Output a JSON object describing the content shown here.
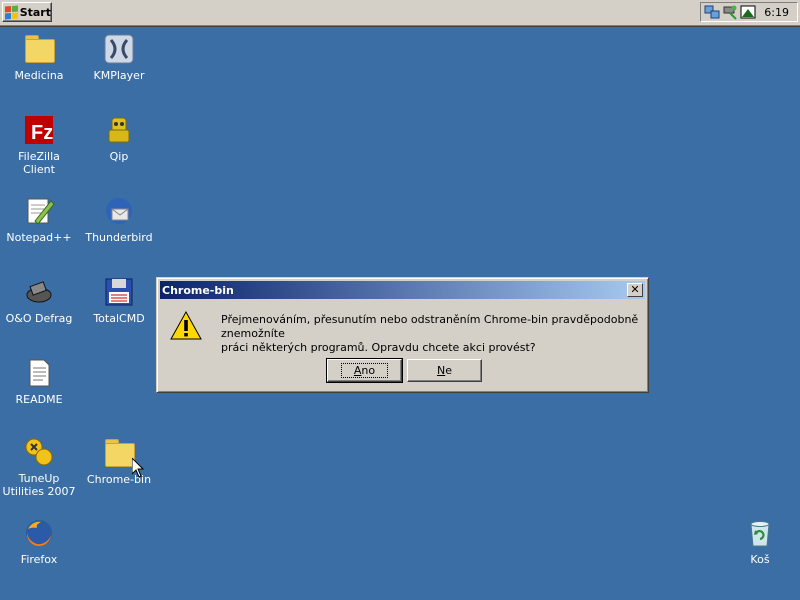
{
  "taskbar": {
    "start_label": "Start",
    "clock": "6:19",
    "tray_icons": [
      "network-icon",
      "safely-remove-icon",
      "app-tray-icon"
    ]
  },
  "desktop": {
    "icons": [
      {
        "label": "Medicina",
        "icon": "folder-icon"
      },
      {
        "label": "KMPlayer",
        "icon": "kmplayer-icon"
      },
      {
        "label": "FileZilla Client",
        "icon": "filezilla-icon"
      },
      {
        "label": "Qip",
        "icon": "qip-icon"
      },
      {
        "label": "Notepad++",
        "icon": "notepad-icon"
      },
      {
        "label": "Thunderbird",
        "icon": "thunderbird-icon"
      },
      {
        "label": "O&O Defrag",
        "icon": "defrag-icon"
      },
      {
        "label": "TotalCMD",
        "icon": "floppy-icon"
      },
      {
        "label": "README",
        "icon": "document-icon"
      },
      {
        "label": "TuneUp Utilities 2007",
        "icon": "tuneup-icon"
      },
      {
        "label": "Chrome-bin",
        "icon": "folder-icon"
      },
      {
        "label": "Firefox",
        "icon": "firefox-icon"
      },
      {
        "label": "Koš",
        "icon": "recycle-bin-icon"
      }
    ]
  },
  "dialog": {
    "title": "Chrome-bin",
    "message_line1": "Přejmenováním, přesunutím nebo odstraněním Chrome-bin pravděpodobně znemožníte",
    "message_line2": "práci některých programů. Opravdu chcete akci provést?",
    "yes_mnemonic": "A",
    "yes_rest": "no",
    "no_mnemonic": "N",
    "no_rest": "e",
    "close_glyph": "✕"
  },
  "colors": {
    "desktop": "#3a6ea5",
    "titlebar_start": "#0a246a",
    "titlebar_end": "#a6caf0",
    "face": "#d4d0c8"
  }
}
